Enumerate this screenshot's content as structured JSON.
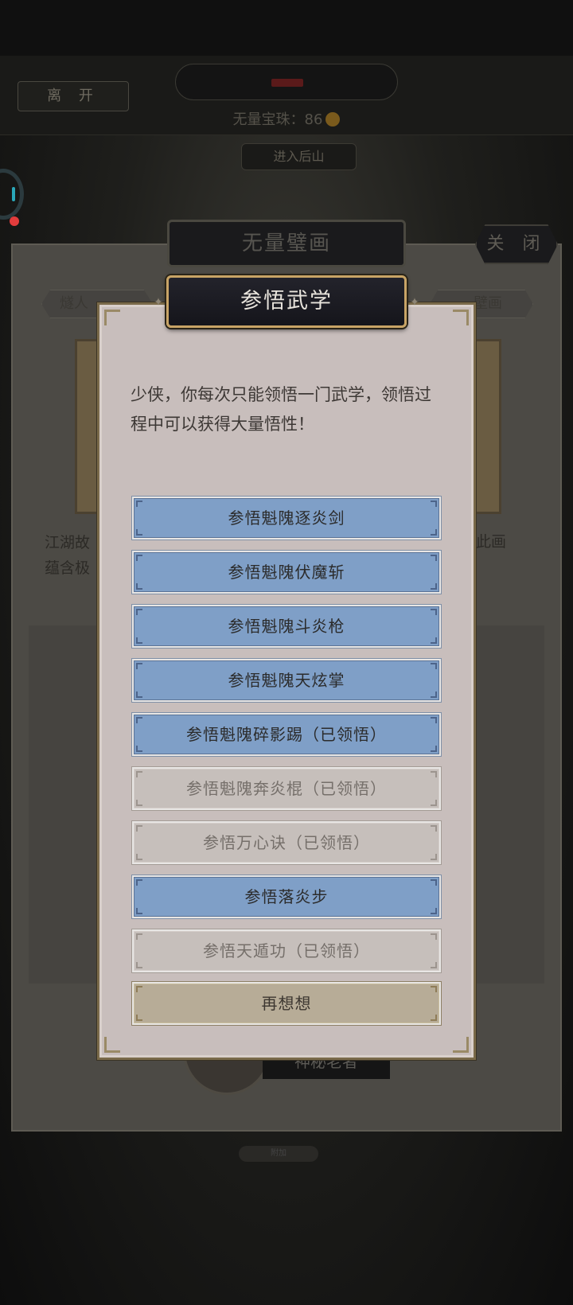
{
  "background": {
    "leave_label": "离 开",
    "gem_label": "无量宝珠：86",
    "enter_label": "进入后山",
    "mural_title": "无量璧画",
    "close_label": "关 闭",
    "tab_left": "燧人",
    "tab_right": "壁画",
    "text_left": "江湖故",
    "text_left_2": "蕴含极",
    "text_right": "此画",
    "elder_label": "神秘老者",
    "bottom_label": "附加"
  },
  "modal": {
    "title": "参悟武学",
    "description": "少侠，你每次只能领悟一门武学，领悟过程中可以获得大量悟性！",
    "options": [
      {
        "label": "参悟魁隗逐炎剑",
        "state": "active"
      },
      {
        "label": "参悟魁隗伏魔斩",
        "state": "active"
      },
      {
        "label": "参悟魁隗斗炎枪",
        "state": "active"
      },
      {
        "label": "参悟魁隗天炫掌",
        "state": "active"
      },
      {
        "label": "参悟魁隗碎影踢（已领悟）",
        "state": "active"
      },
      {
        "label": "参悟魁隗奔炎棍（已领悟）",
        "state": "done"
      },
      {
        "label": "参悟万心诀（已领悟）",
        "state": "done"
      },
      {
        "label": "参悟落炎步",
        "state": "active"
      },
      {
        "label": "参悟天遁功（已领悟）",
        "state": "done"
      }
    ],
    "cancel_label": "再想想"
  },
  "colors": {
    "option_active": "#7f9fc7",
    "option_done": "#c6bfbb",
    "cancel_bg": "#b7ac97",
    "modal_bg": "#c8bebc",
    "title_border": "#c8a466"
  }
}
